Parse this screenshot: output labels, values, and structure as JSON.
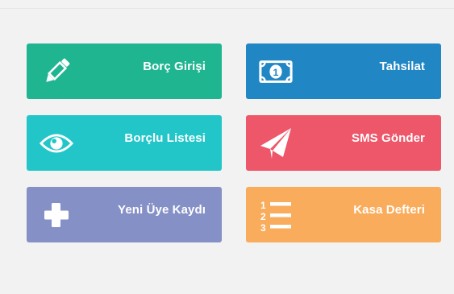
{
  "tiles": [
    {
      "label": "Borç Girişi",
      "icon": "pencil-icon",
      "color": "#1fb590"
    },
    {
      "label": "Tahsilat",
      "icon": "money-bill-icon",
      "color": "#2186c4"
    },
    {
      "label": "Borçlu Listesi",
      "icon": "eye-icon",
      "color": "#22c6c9"
    },
    {
      "label": "SMS Gönder",
      "icon": "paper-plane-icon",
      "color": "#ee5669"
    },
    {
      "label": "Yeni Üye Kaydı",
      "icon": "plus-icon",
      "color": "#8590c6"
    },
    {
      "label": "Kasa Defteri",
      "icon": "numbered-list-icon",
      "color": "#f9ac5b"
    }
  ]
}
